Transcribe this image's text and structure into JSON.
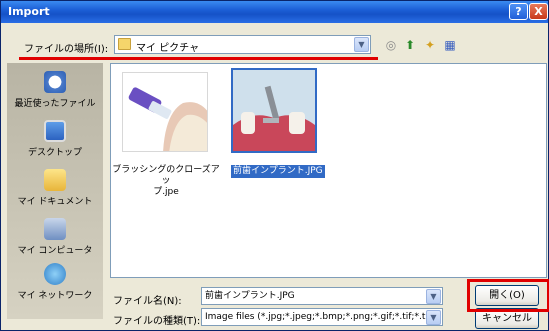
{
  "window": {
    "title": "Import",
    "help_symbol": "?",
    "close_symbol": "X"
  },
  "lookin": {
    "label": "ファイルの場所(I):",
    "value": "マイ ピクチャ"
  },
  "places": [
    {
      "label": "最近使ったファイル",
      "icon": "recent-icon"
    },
    {
      "label": "デスクトップ",
      "icon": "desktop-icon"
    },
    {
      "label": "マイ ドキュメント",
      "icon": "my-documents-icon"
    },
    {
      "label": "マイ コンピュータ",
      "icon": "my-computer-icon"
    },
    {
      "label": "マイ ネットワーク",
      "icon": "my-network-icon"
    }
  ],
  "files": [
    {
      "name_line1": "ブラッシングのクローズアッ",
      "name_line2": "プ.jpe",
      "selected": false
    },
    {
      "name": "前歯インプラント.JPG",
      "selected": true
    }
  ],
  "filename": {
    "label": "ファイル名(N):",
    "value": "前歯インプラント.JPG"
  },
  "filetype": {
    "label": "ファイルの種類(T):",
    "value": "Image files (*.jpg;*.jpeg;*.bmp;*.png;*.gif;*.tif;*.tiff)"
  },
  "buttons": {
    "open": "開く(O)",
    "cancel": "キャンセル"
  },
  "colors": {
    "highlight": "#e00000",
    "selection": "#316ac5"
  }
}
